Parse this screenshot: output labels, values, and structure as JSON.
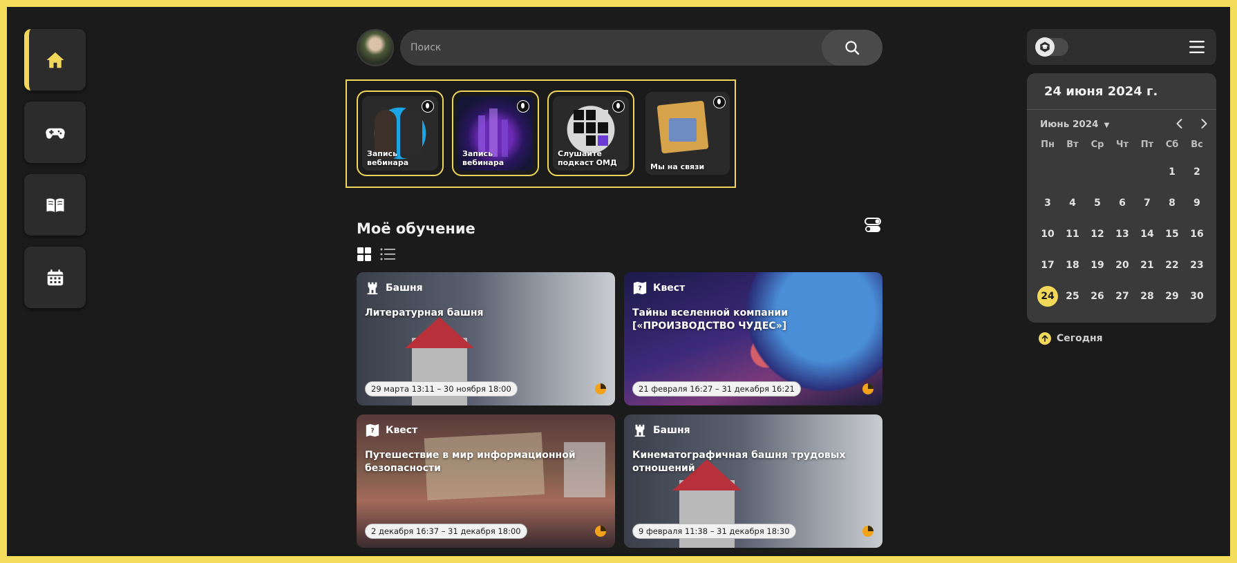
{
  "search": {
    "placeholder": "Поиск"
  },
  "stories": [
    {
      "label": "Запись вебинара"
    },
    {
      "label": "Запись вебинара"
    },
    {
      "label": "Слушайте подкаст ОМД"
    },
    {
      "label": "Мы на связи"
    }
  ],
  "section": {
    "title": "Моё обучение"
  },
  "cards": [
    {
      "type": "Башня",
      "title": "Литературная башня",
      "date": "29 марта 13:11 – 30 ноября 18:00"
    },
    {
      "type": "Квест",
      "title": "Тайны вселенной компании [«ПРОИЗВОДСТВО ЧУДЕС»]",
      "date": "21 февраля 16:27 – 31 декабря 16:21"
    },
    {
      "type": "Квест",
      "title": "Путешествие в мир информационной безопасности",
      "date": "2 декабря 16:37 – 31 декабря 18:00"
    },
    {
      "type": "Башня",
      "title": "Кинематографичная башня трудовых отношений",
      "date": "9 февраля 11:38 – 31 декабря 18:30"
    }
  ],
  "calendar": {
    "header": "24 июня 2024 г.",
    "month": "Июнь 2024",
    "caret": "▼",
    "weekdays": [
      "Пн",
      "Вт",
      "Ср",
      "Чт",
      "Пт",
      "Сб",
      "Вс"
    ],
    "days": [
      [
        "",
        "",
        "",
        "",
        "",
        "1",
        "2"
      ],
      [
        "3",
        "4",
        "5",
        "6",
        "7",
        "8",
        "9"
      ],
      [
        "10",
        "11",
        "12",
        "13",
        "14",
        "15",
        "16"
      ],
      [
        "17",
        "18",
        "19",
        "20",
        "21",
        "22",
        "23"
      ],
      [
        "24",
        "25",
        "26",
        "27",
        "28",
        "29",
        "30"
      ]
    ],
    "today": "Сегодня"
  },
  "colors": {
    "accent": "#f1d75a",
    "background": "#1b1b1b",
    "panel": "#3a3a3a"
  }
}
